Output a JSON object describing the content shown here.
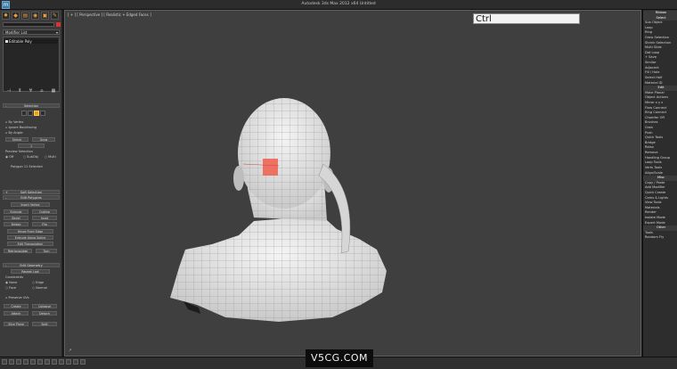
{
  "window": {
    "title": "Autodesk 3ds Max 2012 x64     Untitled"
  },
  "viewport": {
    "label": "[ + ] [ Perspective ] [ Realistic + Edged Faces ]",
    "key_overlay": "Ctrl"
  },
  "left_panel": {
    "modifier_list": "Modifier List",
    "stack_item": "Editable Poly",
    "selection_rollout": "Selection",
    "by_vertex": "By Vertex",
    "ignore_backfacing": "Ignore Backfacing",
    "by_angle": "By Angle:",
    "shrink": "Shrink",
    "grow": "Grow",
    "ring": "1",
    "preview_selection": "Preview Selection",
    "off": "Off",
    "subobj": "SubObj",
    "multi": "Multi",
    "selected_status": "Polygon 11 Selected",
    "soft_selection": "Soft Selection",
    "edit_polygons": "Edit Polygons",
    "insert_vertex": "Insert Vertex",
    "extrude": "Extrude",
    "outline": "Outline",
    "bevel": "Bevel",
    "inset": "Inset",
    "bridge": "Bridge",
    "flip": "Flip",
    "hinge": "Hinge From Edge",
    "extrude_spline": "Extrude Along Spline",
    "edit_tri": "Edit Triangulation",
    "retriangulate": "Retriangulate",
    "turn": "Turn",
    "edit_geometry": "Edit Geometry",
    "repeat_last": "Repeat Last",
    "constraints": "Constraints",
    "none": "None",
    "edge": "Edge",
    "face": "Face",
    "normal": "Normal",
    "preserve_uvs": "Preserve UVs",
    "create": "Create",
    "collapse": "Collapse",
    "attach": "Attach",
    "detach": "Detach",
    "slice_plane": "Slice Plane",
    "split": "Split"
  },
  "right_panel": {
    "items": [
      "Ribbon",
      "Select",
      "Sub Object",
      "Loop",
      "Ring",
      "Grow Selection",
      "Shrink Selection",
      "Multi Slide",
      "Dot Loop",
      "+ Save",
      "Similar",
      "Adjacent",
      "Fill / Hole",
      "Select Half",
      "Material ID",
      "Edit",
      "Make Planar",
      "Object Actions",
      "Mirror x y z",
      "Flow Connect",
      "Ring Connect",
      "Chamfer Off",
      "Brushes",
      "Grab",
      "Push",
      "Quick Tools",
      "Bridge",
      "Relax",
      "Remove",
      "Handling Group",
      "Loop Tools",
      "Verts Tools",
      "Align/Scale",
      "Misc",
      "Copy / Paste",
      "Add Modifier",
      "Quick Create",
      "Cams & Lights",
      "View Tools",
      "Materials",
      "Render",
      "Isolate Mode",
      "Expert Mode",
      "Other",
      "Tools",
      "Random Fly"
    ]
  },
  "watermark": "V5CG.COM",
  "colors": {
    "selection": "#e8a020",
    "selected_face": "#ee6655",
    "viewport_bg": "#3f3f3f"
  },
  "icons": [
    "create-icon",
    "modify-icon",
    "hierarchy-icon",
    "motion-icon",
    "display-icon",
    "utilities-icon"
  ]
}
